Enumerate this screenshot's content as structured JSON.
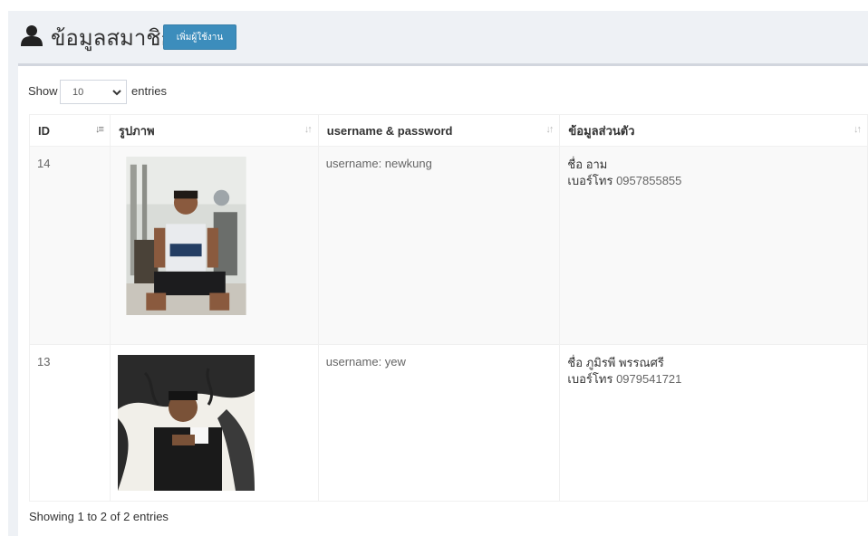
{
  "header": {
    "title": "ข้อมูลสมาชิก",
    "add_button_label": "เพิ่มผู้ใช้งาน",
    "icon": "user-icon"
  },
  "length_menu": {
    "show_label": "Show",
    "selected_value": "10",
    "entries_label": "entries"
  },
  "table": {
    "columns": [
      {
        "label": "ID"
      },
      {
        "label": "รูปภาพ"
      },
      {
        "label": "username & password"
      },
      {
        "label": "ข้อมูลส่วนตัว"
      }
    ],
    "rows": [
      {
        "id": "14",
        "username": "username: newkung",
        "name_label": "ชื่อ",
        "name_value": "อาม",
        "phone_label": "เบอร์โทร",
        "phone_value": "0957855855"
      },
      {
        "id": "13",
        "username": "username: yew",
        "name_label": "ชื่อ",
        "name_value": "ภูมิรพี พรรณศรี",
        "phone_label": "เบอร์โทร",
        "phone_value": "0979541721"
      }
    ]
  },
  "footer": {
    "info": "Showing 1 to 2 of 2 entries"
  },
  "colors": {
    "primary_button": "#3c8dbc",
    "page_background": "#eef1f5"
  }
}
